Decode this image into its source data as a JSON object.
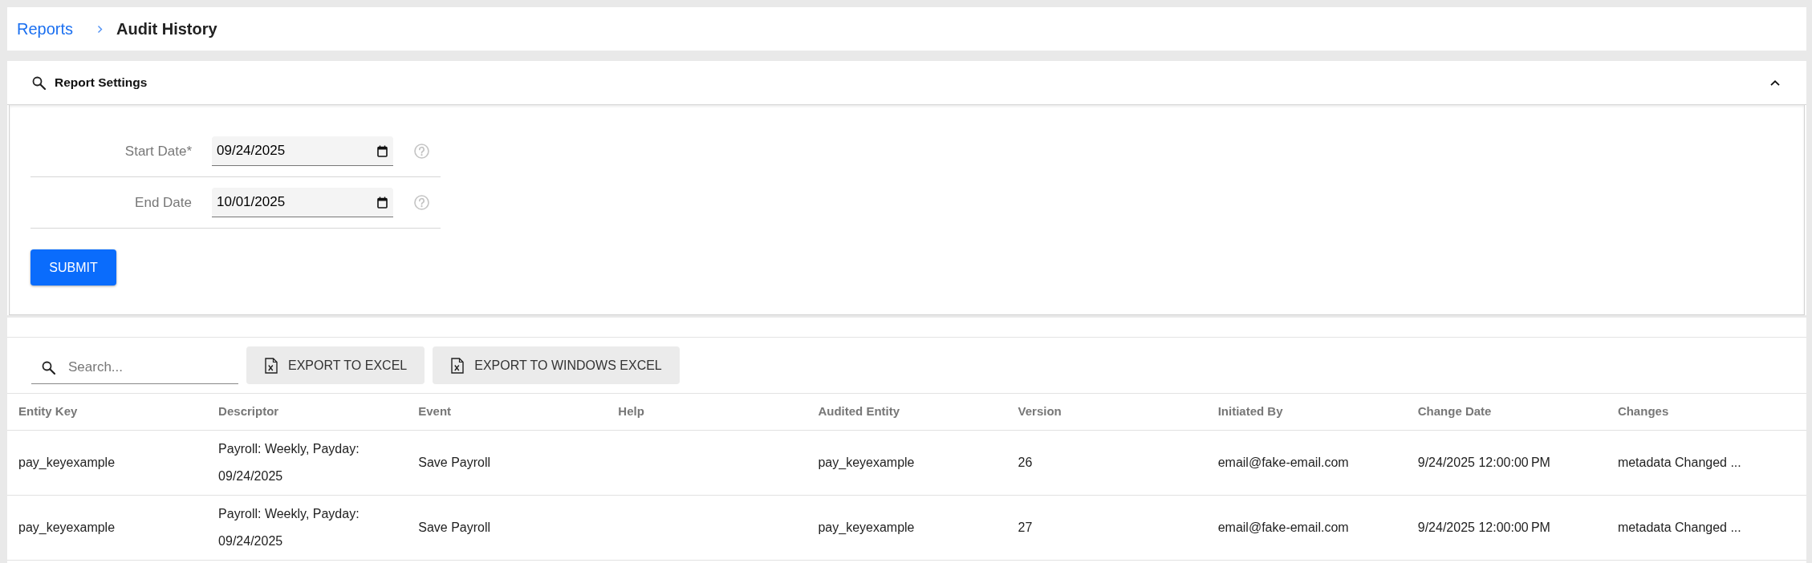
{
  "breadcrumb": [
    "Reports",
    "Audit History"
  ],
  "report_settings": {
    "title": "Report Settings",
    "expanded": true,
    "fields": [
      {
        "label": "Start Date*",
        "value": "09/24/2025"
      },
      {
        "label": "End Date",
        "value": "10/01/2025"
      }
    ],
    "submit": "SUBMIT"
  },
  "toolbar": {
    "search": {
      "placeholder": "Search..."
    },
    "buttons": [
      "EXPORT TO EXCEL",
      "EXPORT TO WINDOWS EXCEL"
    ]
  },
  "table": {
    "columns": [
      "Entity Key",
      "Descriptor",
      "Event",
      "Help",
      "Audited Entity",
      "Version",
      "Initiated By",
      "Change Date",
      "Changes"
    ],
    "rows": [
      {
        "entity_key": "pay_keyexample",
        "descriptor": "Payroll: Weekly, Payday: 09/24/2025",
        "event": "Save Payroll",
        "audited_entity": "pay_keyexample",
        "version": "26",
        "initiated_by": "email@fake-email.com",
        "change_date": "9/24/2025 12:00:00 PM",
        "changes": "metadata Changed ..."
      },
      {
        "entity_key": "pay_keyexample",
        "descriptor": "Payroll: Weekly, Payday: 09/24/2025",
        "event": "Save Payroll",
        "audited_entity": "pay_keyexample",
        "version": "27",
        "initiated_by": "email@fake-email.com",
        "change_date": "9/24/2025 12:00:00 PM",
        "changes": "metadata Changed ..."
      }
    ]
  }
}
